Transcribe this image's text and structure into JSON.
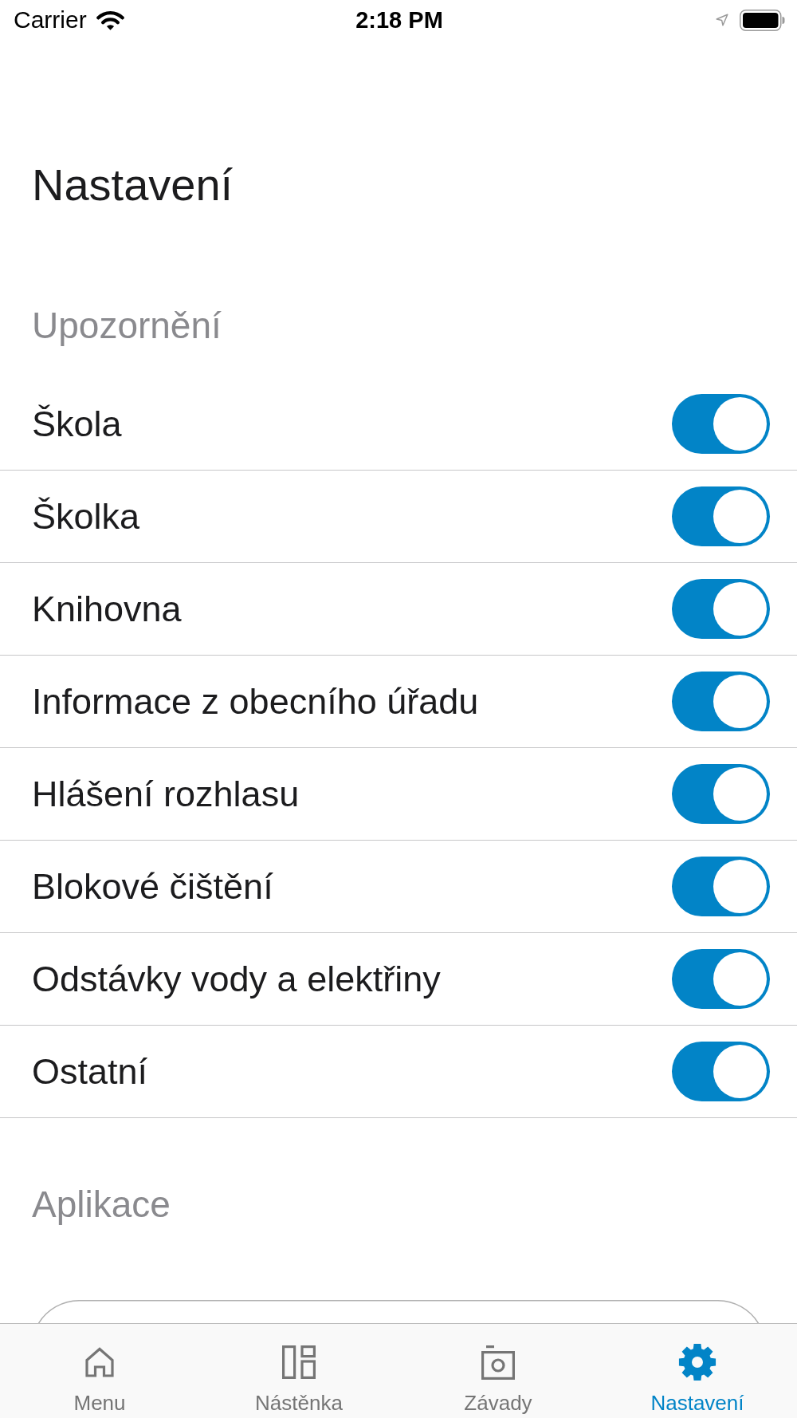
{
  "status_bar": {
    "carrier": "Carrier",
    "time": "2:18 PM"
  },
  "header": {
    "title": "Nastavení"
  },
  "sections": [
    {
      "title": "Upozornění",
      "kind": "toggles",
      "rows": [
        {
          "label": "Škola",
          "on": true
        },
        {
          "label": "Školka",
          "on": true
        },
        {
          "label": "Knihovna",
          "on": true
        },
        {
          "label": "Informace z obecního úřadu",
          "on": true
        },
        {
          "label": "Hlášení rozhlasu",
          "on": true
        },
        {
          "label": "Blokové čištění",
          "on": true
        },
        {
          "label": "Odstávky vody a elektřiny",
          "on": true
        },
        {
          "label": "Ostatní",
          "on": true
        }
      ]
    },
    {
      "title": "Aplikace",
      "kind": "card"
    }
  ],
  "tab_bar": {
    "items": [
      {
        "label": "Menu",
        "selected": false
      },
      {
        "label": "Nástěnka",
        "selected": false
      },
      {
        "label": "Závady",
        "selected": false
      },
      {
        "label": "Nastavení",
        "selected": true
      }
    ]
  }
}
